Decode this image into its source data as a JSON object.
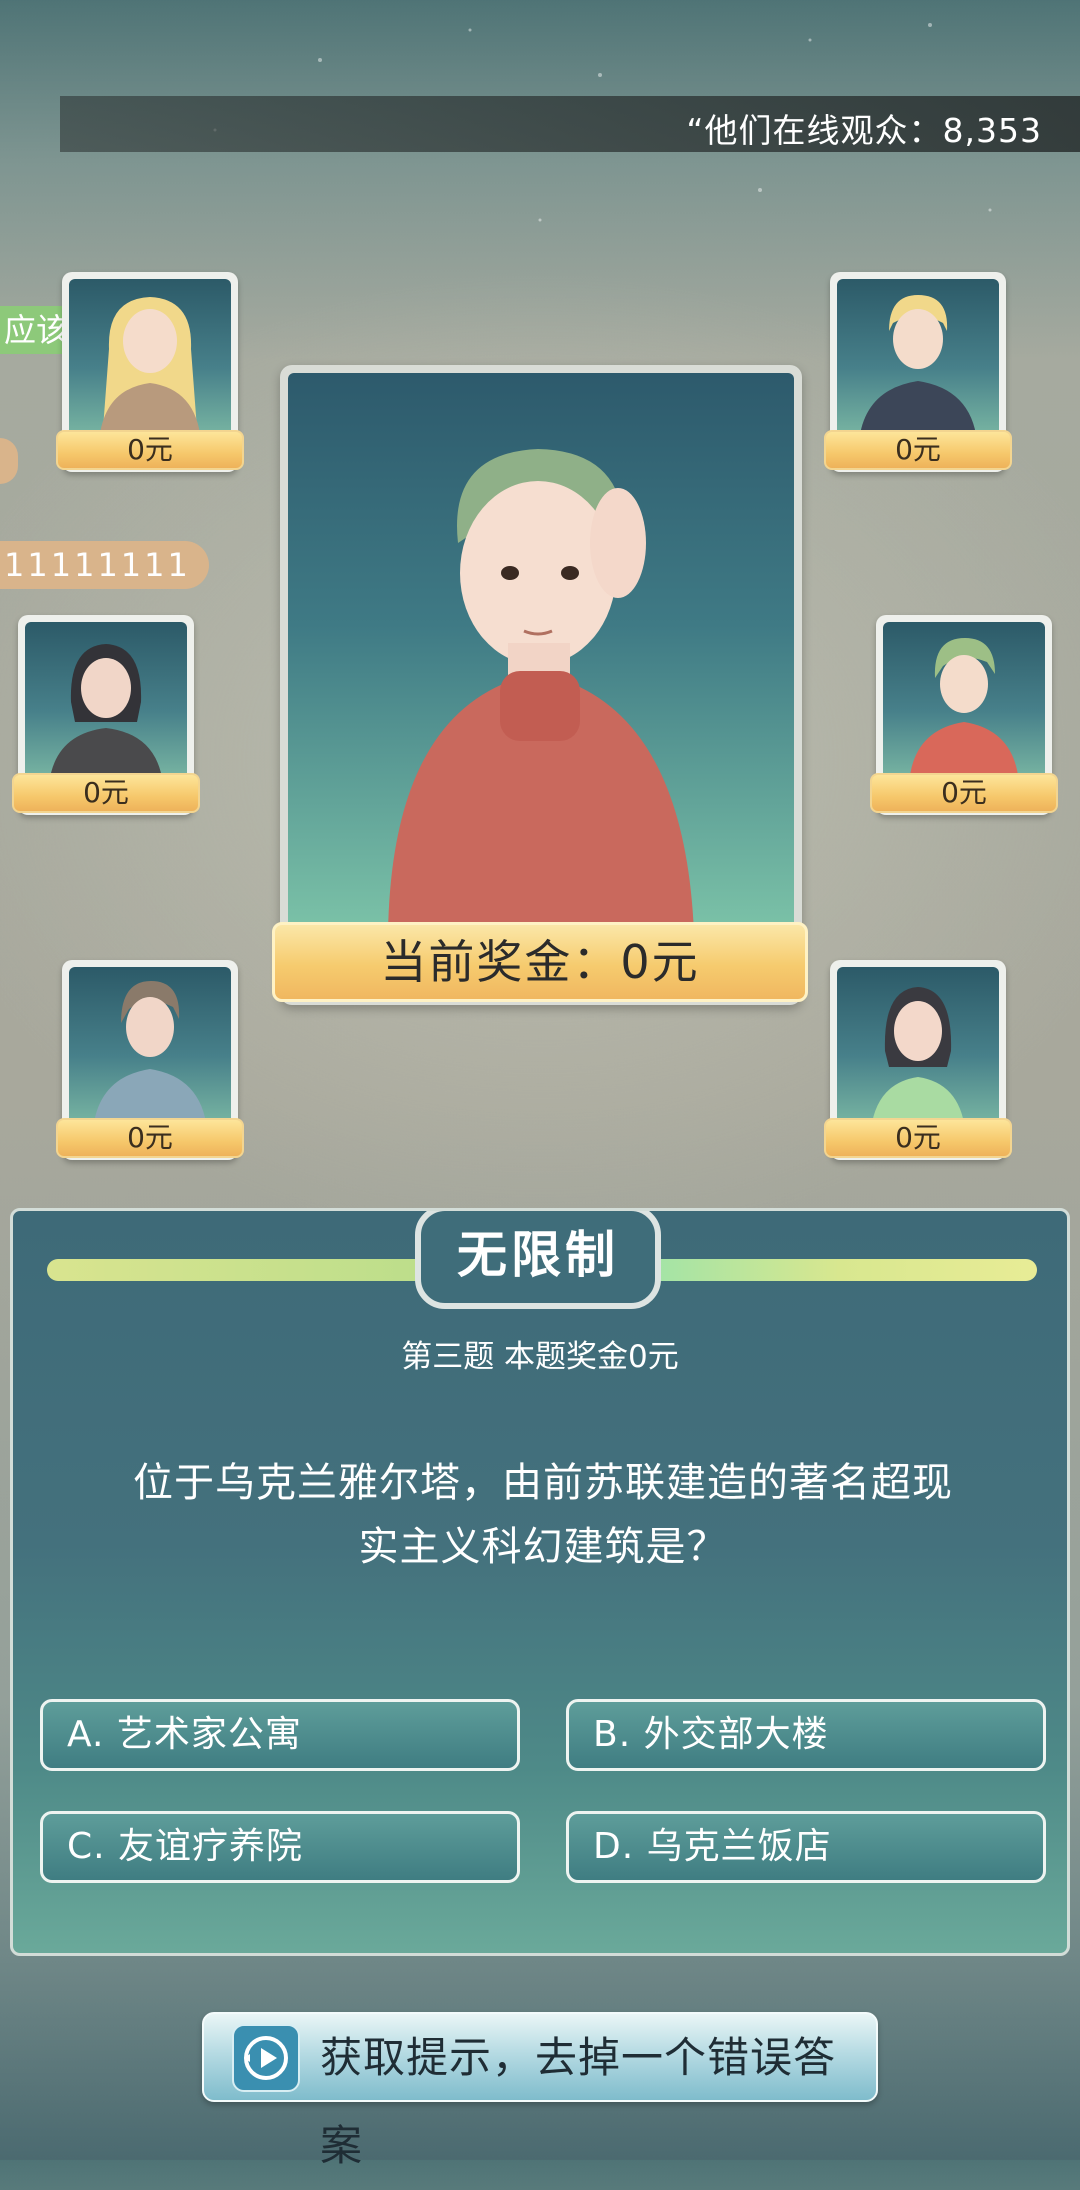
{
  "header": {
    "viewers_text": "“他们在线观众：8,353"
  },
  "chat": {
    "bubble_1": "应该是",
    "bubble_3": "11111111"
  },
  "contestants": [
    {
      "prize": "0元"
    },
    {
      "prize": "0元"
    },
    {
      "prize": "0元"
    },
    {
      "prize": "0元"
    },
    {
      "prize": "0元"
    },
    {
      "prize": "0元"
    }
  ],
  "player": {
    "prize_text": "当前奖金：0元"
  },
  "question_panel": {
    "mode": "无限制",
    "meta": "第三题  本题奖金0元",
    "question_line1": "位于乌克兰雅尔塔，由前苏联建造的著名超现",
    "question_line2": "实主义科幻建筑是？",
    "options": [
      {
        "label": "A. 艺术家公寓"
      },
      {
        "label": "B. 外交部大楼"
      },
      {
        "label": "C. 友谊疗养院"
      },
      {
        "label": "D. 乌克兰饭店"
      }
    ]
  },
  "hint": {
    "label": "获取提示，去掉一个错误答案",
    "icon": "play-hint-icon"
  },
  "colors": {
    "prize_gold": "#f6c86b",
    "panel_teal": "#44717d",
    "chat_green": "#8dc97a",
    "chat_tan": "#d9b48b"
  }
}
